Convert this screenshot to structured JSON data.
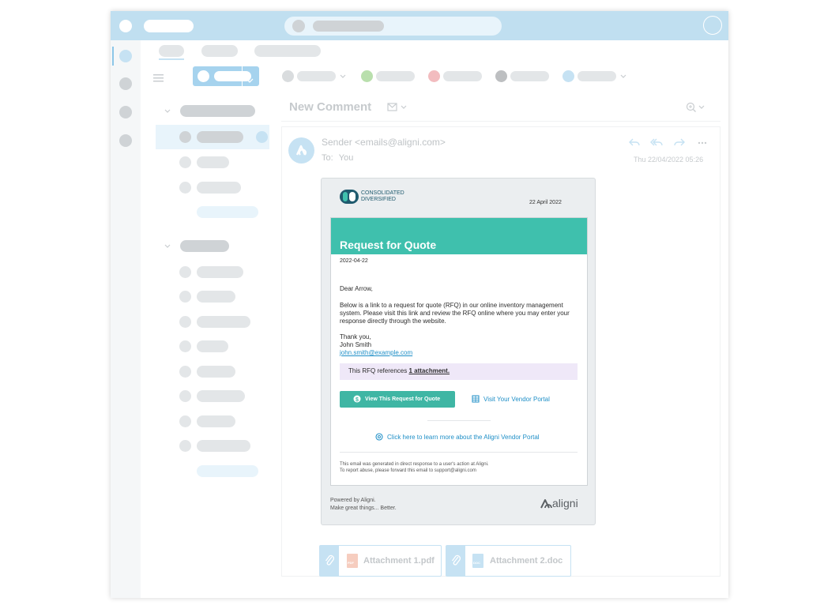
{
  "header": {
    "title": "New Comment"
  },
  "message": {
    "sender": "Sender <emails@aligni.com>",
    "to_label": "To:",
    "to_value": "You",
    "date": "Thu 22/04/2022 05:26"
  },
  "email": {
    "logo_line1": "CONSOLIDATED",
    "logo_line2": "DIVERSIFIED",
    "header_date": "22 April 2022",
    "banner_title": "Request for Quote",
    "date": "2022-04-22",
    "greeting": "Dear Arrow,",
    "body_line1": "Below is a link to a request for quote (RFQ) in our online inventory management",
    "body_line2": "system. Please visit this link and review the RFQ online where you may enter your",
    "body_line3": "response directly through the website.",
    "thanks": "Thank you,",
    "signer": "John Smith",
    "signer_email": "john.smith@example.com",
    "note_prefix": "This RFQ references",
    "note_link": "1 attachment.",
    "quote_button": "View This Request for Quote",
    "portal_link": "Visit Your Vendor Portal",
    "learn_more": "Click here to learn more about the Aligni Vendor Portal",
    "footer_line1": "This email was generated in direct response to a user's action at Aligni.",
    "footer_line2": "To report abuse, please forward this email to support@aligni.com",
    "powered_line1": "Powered by Aligni.",
    "powered_line2": "Make great things... Better.",
    "brand": "aligni"
  },
  "attachments": [
    {
      "name": "Attachment 1.pdf",
      "type": "PDF"
    },
    {
      "name": "Attachment 2.doc",
      "type": "DOC"
    }
  ],
  "colors": {
    "topbar": "#c0dff0",
    "accent_teal": "#3fc0ad",
    "link_blue": "#1f8fc7",
    "note_bg": "#efe8f8"
  },
  "icons": [
    "avatar-icon",
    "reply-icon",
    "reply-all-icon",
    "forward-icon",
    "more-icon",
    "zoom-icon",
    "paperclip-icon",
    "pdf-file-icon",
    "doc-file-icon",
    "dollar-icon",
    "building-icon",
    "help-icon"
  ]
}
